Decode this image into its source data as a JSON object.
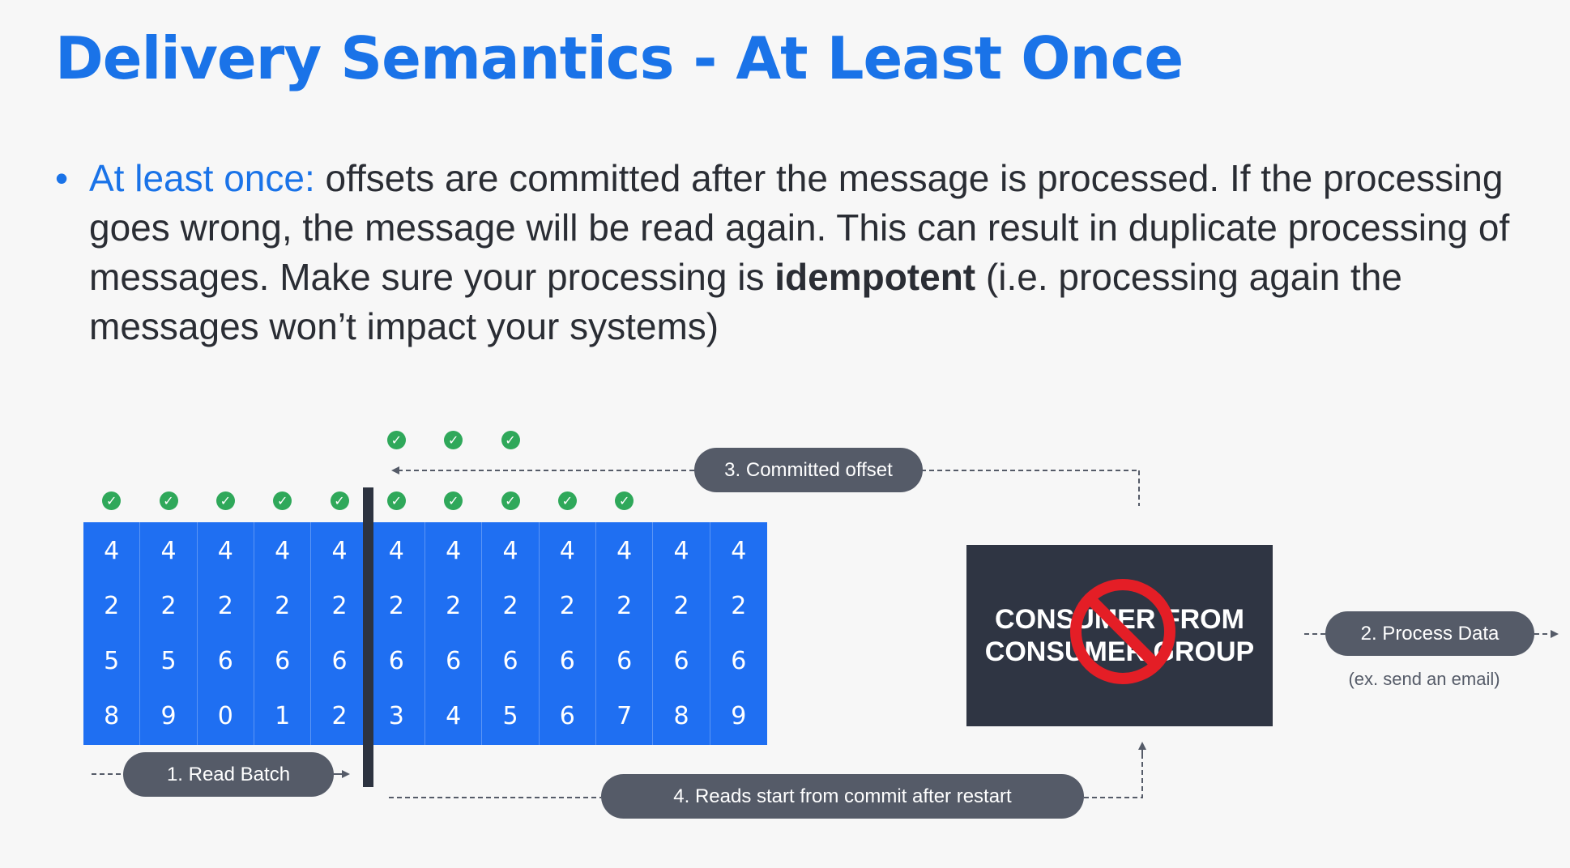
{
  "slide": {
    "title": "Delivery Semantics - At Least Once",
    "bullet": {
      "lead": "At least once:",
      "text_before": " offsets are committed after the message is processed. If the processing goes wrong, the message will be read again. This can result in duplicate processing of messages. Make sure your processing is ",
      "emphasis": "idempotent",
      "text_after": " (i.e. processing again the messages won’t impact your systems)"
    }
  },
  "diagram": {
    "offsets": [
      "4258",
      "4259",
      "4260",
      "4261",
      "4262",
      "4263",
      "4264",
      "4265",
      "4266",
      "4267",
      "4268",
      "4269"
    ],
    "processed_count": 10,
    "upper_checks_count": 3,
    "steps": {
      "read_batch": "1. Read Batch",
      "process_data": "2. Process Data",
      "process_example": "(ex. send an email)",
      "committed_offset": "3. Committed offset",
      "reads_restart": "4. Reads start from commit after restart"
    },
    "consumer": {
      "line1": "CONSUMER FROM",
      "line2": "CONSUMER GROUP",
      "status_icon": "prohibited-icon"
    },
    "colors": {
      "accent": "#1a73e8",
      "partition": "#1f6ff2",
      "check": "#2fa85a",
      "pill": "#555b68",
      "consumer_box": "#2f3543",
      "prohibited": "#e41e26"
    }
  }
}
